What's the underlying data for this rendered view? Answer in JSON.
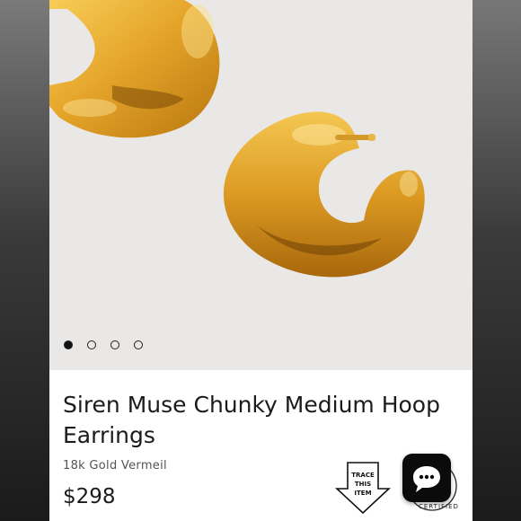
{
  "product": {
    "title": "Siren Muse Chunky Medium Hoop Earrings",
    "material": "18k Gold Vermeil",
    "price": "$298"
  },
  "carousel": {
    "total": 4,
    "active_index": 0
  },
  "badges": {
    "trace_line1": "TRACE",
    "trace_line2": "THIS",
    "trace_line3": "ITEM",
    "certified_text": "CERTIFIED"
  },
  "icons": {
    "chat": "chat-bubble-icon",
    "trace": "down-arrow-icon"
  },
  "colors": {
    "gold": "#e2a52d",
    "background": "#e9e8e6",
    "text": "#1b1b1b"
  }
}
